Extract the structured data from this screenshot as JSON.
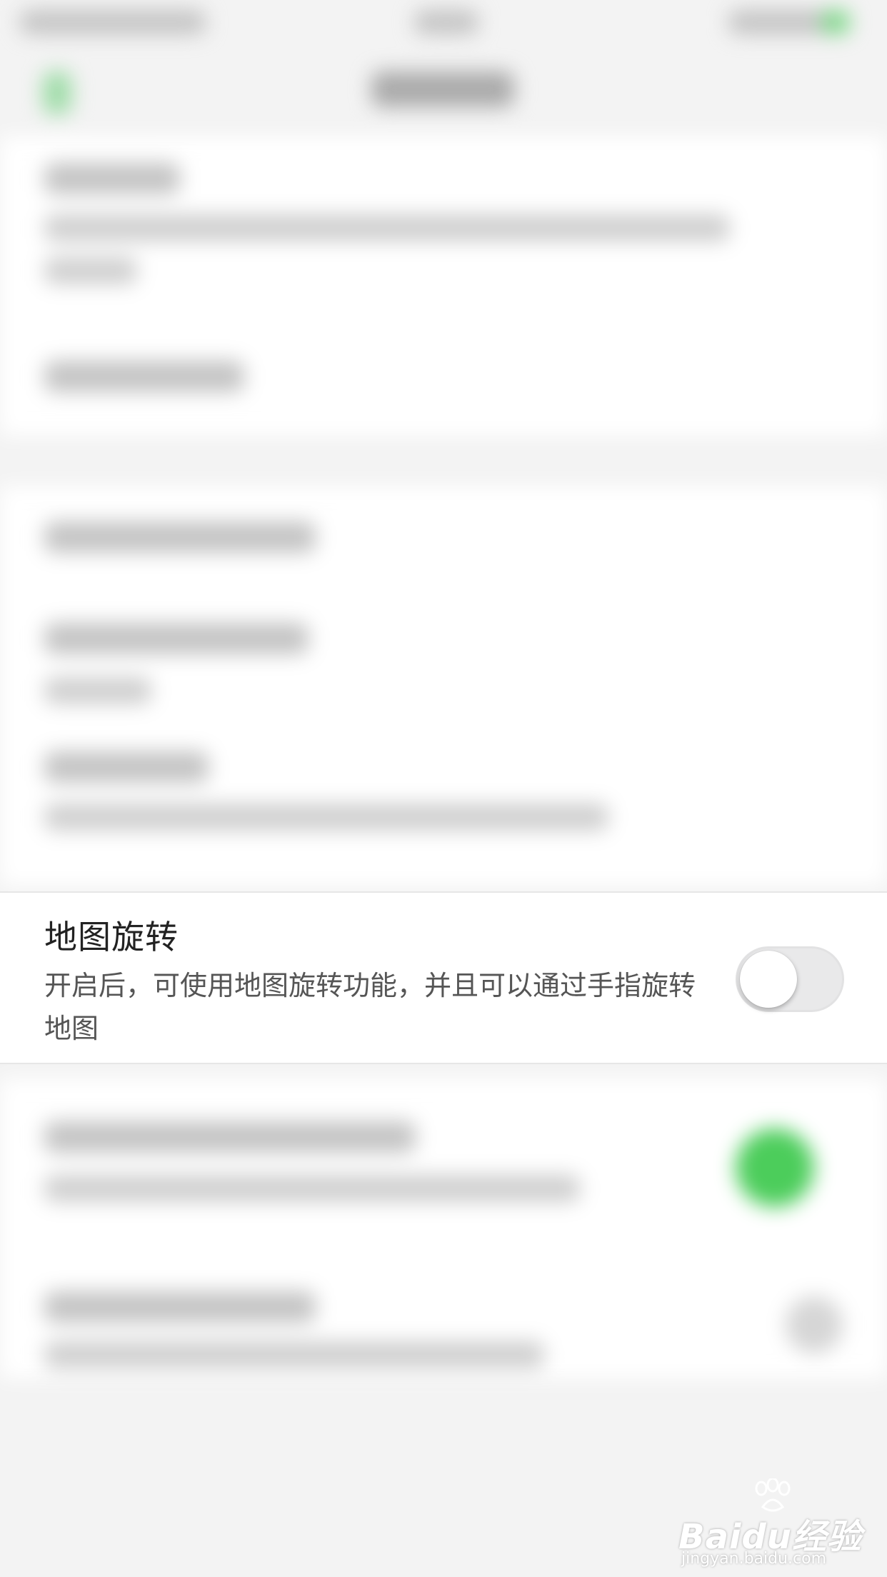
{
  "setting": {
    "title": "地图旋转",
    "description": "开启后，可使用地图旋转功能，并且可以通过手指旋转地图",
    "toggle_state": "off"
  },
  "watermark": {
    "logo": "Baidu经验",
    "url": "jingyan.baidu.com"
  },
  "colors": {
    "background": "#f3f3f3",
    "row_background": "#ffffff",
    "toggle_off": "#e9e9ea",
    "accent_green": "#4ccd5b"
  },
  "icons": {
    "back": "back-arrow-icon",
    "watermark": "baidu-paw-icon"
  }
}
